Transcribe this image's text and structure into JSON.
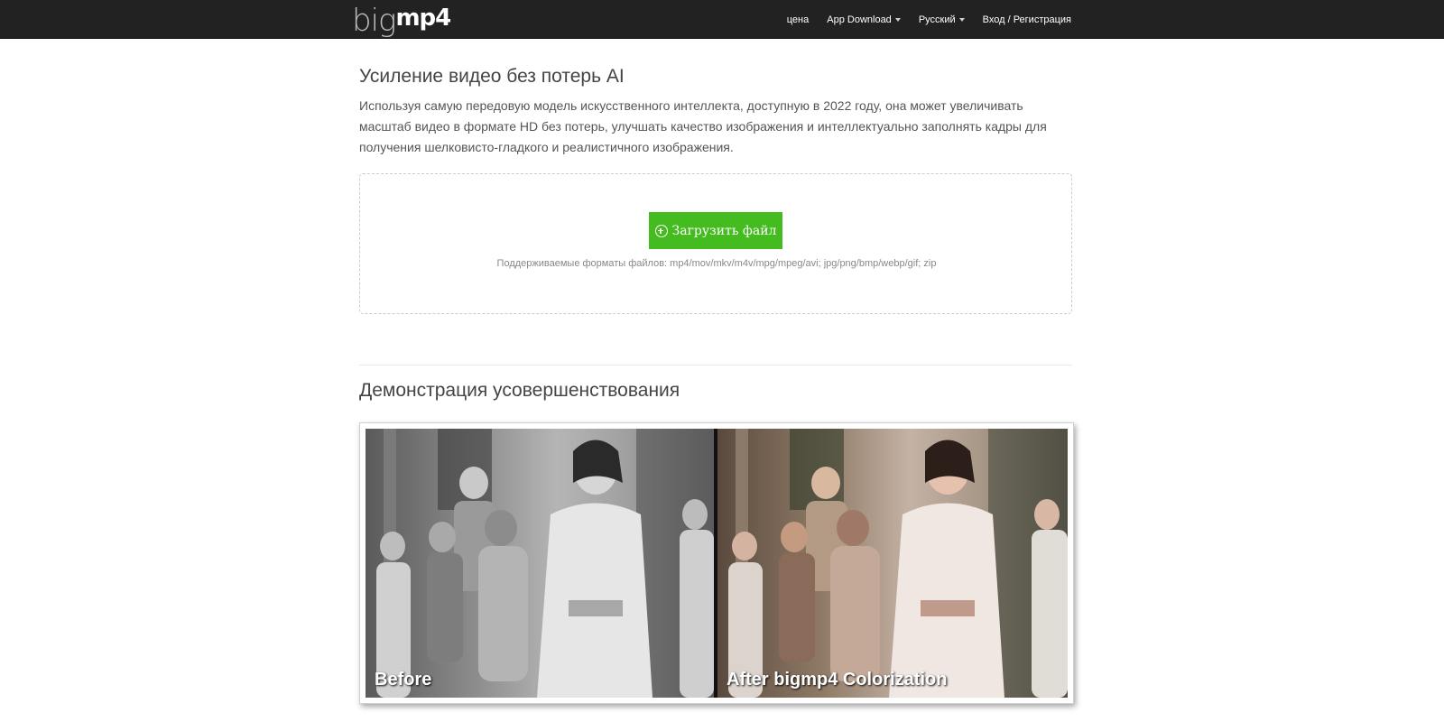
{
  "brand": {
    "part1": "big",
    "part2": "mp4"
  },
  "nav": {
    "items": [
      {
        "label": "цена",
        "dropdown": false
      },
      {
        "label": "App Download",
        "dropdown": true
      },
      {
        "label": "Русский",
        "dropdown": true
      },
      {
        "label": "Вход / Регистрация",
        "dropdown": false
      }
    ]
  },
  "main": {
    "title": "Усиление видео без потерь AI",
    "description": "Используя самую передовую модель искусственного интеллекта, доступную в 2022 году, она может увеличивать масштаб видео в формате HD без потерь, улучшать качество изображения и интеллектуально заполнять кадры для получения шелковисто-гладкого и реалистичного изображения.",
    "upload_label": "Загрузить файл",
    "formats": "Поддерживаемые форматы файлов: mp4/mov/mkv/m4v/mpg/mpeg/avi; jpg/png/bmp/webp/gif; zip"
  },
  "demo": {
    "title": "Демонстрация усовершенствования",
    "before_label": "Before",
    "after_label": "After bigmp4 Colorization"
  },
  "colors": {
    "navbar": "#222222",
    "upload_button": "#44bb1e"
  }
}
